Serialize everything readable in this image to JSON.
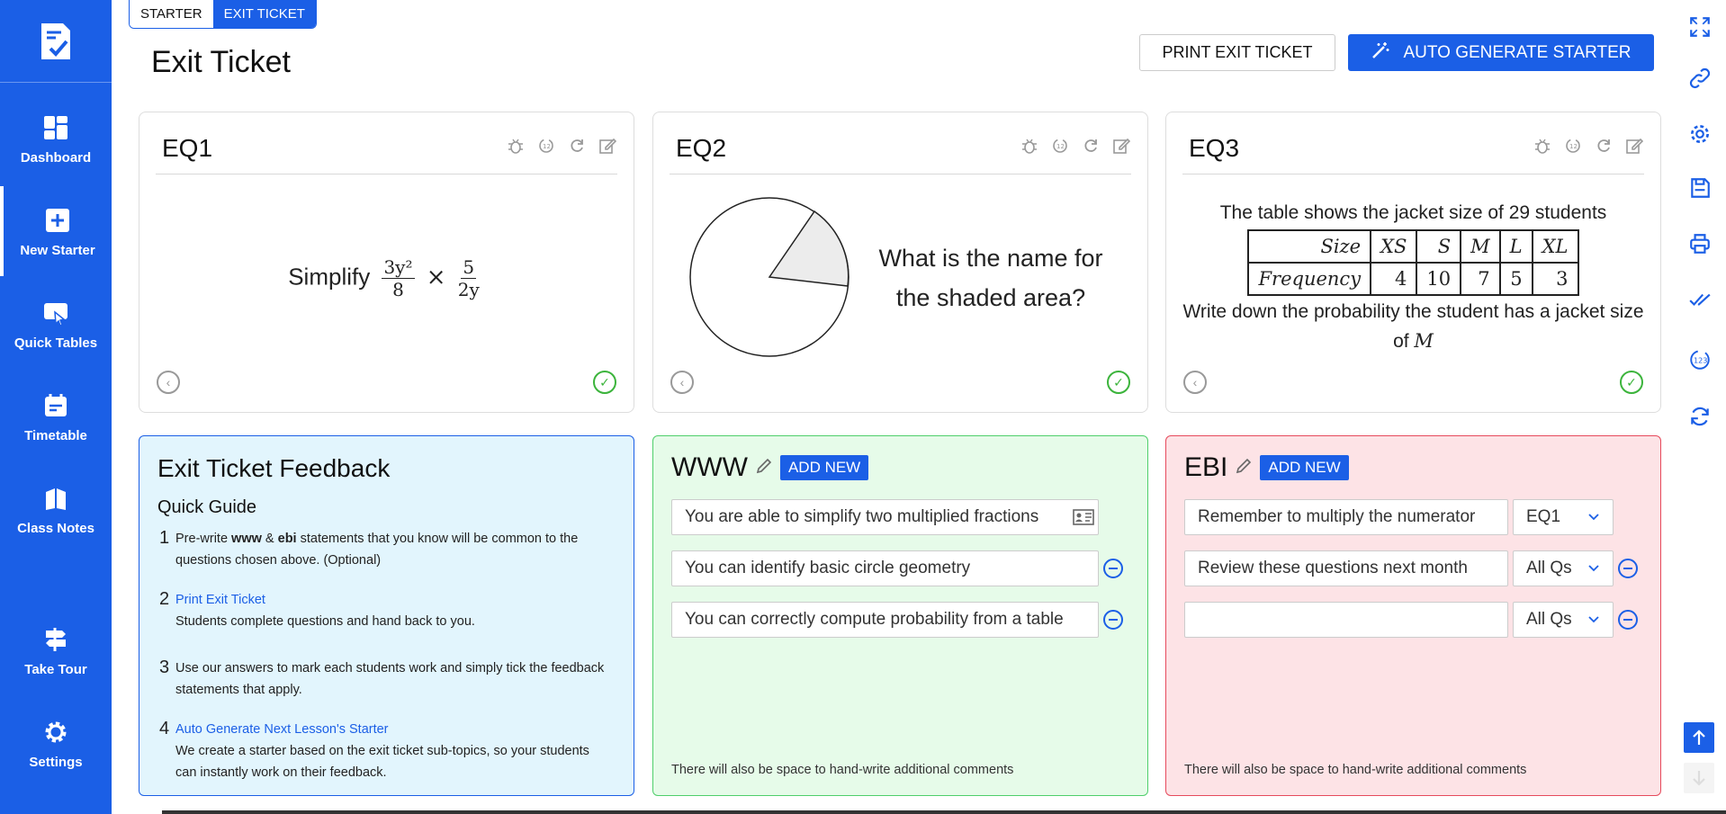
{
  "sidebar": {
    "items": [
      {
        "label": "Dashboard",
        "icon": "dashboard-icon"
      },
      {
        "label": "New Starter",
        "icon": "plus-square-icon"
      },
      {
        "label": "Quick Tables",
        "icon": "quick-tables-icon"
      },
      {
        "label": "Timetable",
        "icon": "calendar-icon"
      },
      {
        "label": "Class Notes",
        "icon": "notes-icon"
      },
      {
        "label": "Take Tour",
        "icon": "signpost-icon"
      },
      {
        "label": "Settings",
        "icon": "gear-icon"
      }
    ],
    "active": "New Starter"
  },
  "tabs": {
    "starter": "STARTER",
    "exit_ticket": "EXIT TICKET",
    "active": "EXIT TICKET"
  },
  "page": {
    "title": "Exit Ticket"
  },
  "toolbar": {
    "print_label": "PRINT EXIT TICKET",
    "auto_label": "AUTO GENERATE STARTER"
  },
  "questions": {
    "q1": {
      "title": "EQ1",
      "prompt": "Simplify",
      "frac1_num": "3y²",
      "frac1_den": "8",
      "op": "×",
      "frac2_num": "5",
      "frac2_den": "2y"
    },
    "q2": {
      "title": "EQ2",
      "text": "What is the name for the shaded area?"
    },
    "q3": {
      "title": "EQ3",
      "intro": "The table shows the jacket size of 29 students",
      "row_headers": [
        "Size",
        "Frequency"
      ],
      "sizes": [
        "XS",
        "S",
        "M",
        "L",
        "XL"
      ],
      "frequencies": [
        "4",
        "10",
        "7",
        "5",
        "3"
      ],
      "outro": "Write down the probability the student has a jacket size of",
      "outro_var": "M"
    }
  },
  "feedback_guide": {
    "title": "Exit Ticket Feedback",
    "subtitle": "Quick Guide",
    "steps": [
      {
        "num": "1",
        "pre": "Pre-write ",
        "b1": "www",
        "mid": " & ",
        "b2": "ebi",
        "rest": " statements that you know will be common to the questions chosen above. (Optional)"
      },
      {
        "num": "2",
        "link": "Print Exit Ticket",
        "text": "Students complete questions and hand back to you."
      },
      {
        "num": "3",
        "text": "Use our answers to mark each students work and simply tick the feedback statements that apply."
      },
      {
        "num": "4",
        "link": "Auto Generate Next Lesson's Starter",
        "text": "We create a starter based on the exit ticket sub-topics, so your students can instantly work on their feedback."
      }
    ]
  },
  "www": {
    "title": "WWW",
    "add_label": "ADD NEW",
    "items": [
      "You are able to simplify two multiplied fractions",
      "You can identify basic circle geometry",
      "You can correctly compute probability from a table"
    ],
    "note": "There will also be space to hand-write additional comments"
  },
  "ebi": {
    "title": "EBI",
    "add_label": "ADD NEW",
    "items": [
      {
        "text": "Remember to multiply the numerator",
        "scope": "EQ1"
      },
      {
        "text": "Review these questions next month",
        "scope": "All Qs"
      },
      {
        "text": "",
        "scope": "All Qs"
      }
    ],
    "note": "There will also be space to hand-write additional comments"
  },
  "colors": {
    "brand": "#1b5fe6",
    "www_bg": "#e6fbe9",
    "ebi_bg": "#fde3e6",
    "guide_bg": "#e2f5fd",
    "check": "#3cb43c"
  }
}
